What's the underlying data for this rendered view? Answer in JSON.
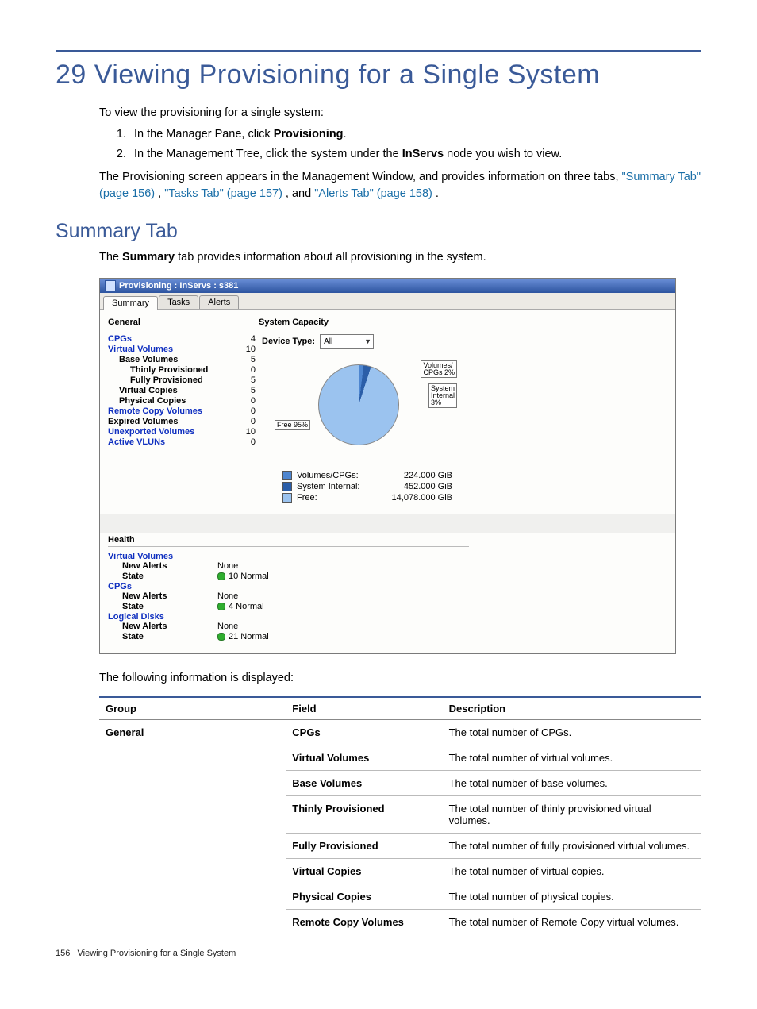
{
  "chapter_title": "29 Viewing Provisioning for a Single System",
  "intro": {
    "lead": "To view the provisioning for a single system:",
    "steps": [
      {
        "pre": "In the Manager Pane, click ",
        "bold": "Provisioning",
        "post": "."
      },
      {
        "pre": "In the Management Tree, click the system under the ",
        "bold": "InServs",
        "post": " node you wish to view."
      }
    ],
    "para_pre": "The Provisioning screen appears in the Management Window, and provides information on three tabs, ",
    "link1": "\"Summary Tab\" (page 156)",
    "sep1": " , ",
    "link2": "\"Tasks Tab\" (page 157)",
    "sep2": " , and ",
    "link3": "\"Alerts Tab\" (page 158)",
    "post": " ."
  },
  "section_title": "Summary Tab",
  "section_para_pre": "The ",
  "section_para_bold": "Summary",
  "section_para_post": " tab provides information about all provisioning in the system.",
  "screenshot": {
    "titlebar": "Provisioning : InServs : s381",
    "tabs": {
      "summary": "Summary",
      "tasks": "Tasks",
      "alerts": "Alerts"
    },
    "general": {
      "header": "General",
      "rows": [
        {
          "label": "CPGs",
          "value": "4",
          "link": true,
          "indent": 0
        },
        {
          "label": "Virtual Volumes",
          "value": "10",
          "link": true,
          "indent": 0
        },
        {
          "label": "Base Volumes",
          "value": "5",
          "link": false,
          "indent": 1
        },
        {
          "label": "Thinly Provisioned",
          "value": "0",
          "link": false,
          "indent": 2
        },
        {
          "label": "Fully Provisioned",
          "value": "5",
          "link": false,
          "indent": 2
        },
        {
          "label": "Virtual Copies",
          "value": "5",
          "link": false,
          "indent": 1
        },
        {
          "label": "Physical Copies",
          "value": "0",
          "link": false,
          "indent": 1
        },
        {
          "label": "Remote Copy Volumes",
          "value": "0",
          "link": true,
          "indent": 0
        },
        {
          "label": "Expired Volumes",
          "value": "0",
          "link": false,
          "indent": 0
        },
        {
          "label": "Unexported Volumes",
          "value": "10",
          "link": true,
          "indent": 0
        },
        {
          "label": "Active VLUNs",
          "value": "0",
          "link": true,
          "indent": 0
        }
      ]
    },
    "capacity": {
      "header": "System Capacity",
      "device_type_label": "Device Type:",
      "device_type_value": "All",
      "callouts": {
        "vol": "Volumes/\nCPGs 2%",
        "sys": "System\nInternal\n3%",
        "free": "Free 95%"
      },
      "legend": [
        {
          "label": "Volumes/CPGs:",
          "value": "224.000 GiB",
          "color": "#4e86d0"
        },
        {
          "label": "System Internal:",
          "value": "452.000 GiB",
          "color": "#2b5ea8"
        },
        {
          "label": "Free:",
          "value": "14,078.000 GiB",
          "color": "#9bc3ef"
        }
      ]
    },
    "health": {
      "header": "Health",
      "groups": [
        {
          "title": "Virtual Volumes",
          "rows": [
            {
              "label": "New Alerts",
              "value": "None",
              "dot": false
            },
            {
              "label": "State",
              "value": "10 Normal",
              "dot": true
            }
          ]
        },
        {
          "title": "CPGs",
          "rows": [
            {
              "label": "New Alerts",
              "value": "None",
              "dot": false
            },
            {
              "label": "State",
              "value": "4 Normal",
              "dot": true
            }
          ]
        },
        {
          "title": "Logical Disks",
          "rows": [
            {
              "label": "New Alerts",
              "value": "None",
              "dot": false
            },
            {
              "label": "State",
              "value": "21 Normal",
              "dot": true
            }
          ]
        }
      ]
    }
  },
  "following_info": "The following information is displayed:",
  "table": {
    "headers": {
      "group": "Group",
      "field": "Field",
      "desc": "Description"
    },
    "group_label": "General",
    "rows": [
      {
        "field": "CPGs",
        "desc": "The total number of CPGs."
      },
      {
        "field": "Virtual Volumes",
        "desc": "The total number of virtual volumes."
      },
      {
        "field": "Base Volumes",
        "desc": "The total number of base volumes."
      },
      {
        "field": "Thinly Provisioned",
        "desc": "The total number of thinly provisioned virtual volumes."
      },
      {
        "field": "Fully Provisioned",
        "desc": "The total number of fully provisioned virtual volumes."
      },
      {
        "field": "Virtual Copies",
        "desc": "The total number of virtual copies."
      },
      {
        "field": "Physical Copies",
        "desc": "The total number of physical copies."
      },
      {
        "field": "Remote Copy Volumes",
        "desc": "The total number of Remote Copy virtual volumes."
      }
    ]
  },
  "footer": {
    "page": "156",
    "title": "Viewing Provisioning for a Single System"
  },
  "chart_data": {
    "type": "pie",
    "title": "System Capacity",
    "categories": [
      "Volumes/CPGs",
      "System Internal",
      "Free"
    ],
    "values": [
      224.0,
      452.0,
      14078.0
    ],
    "unit": "GiB",
    "percentages": [
      2,
      3,
      95
    ]
  }
}
